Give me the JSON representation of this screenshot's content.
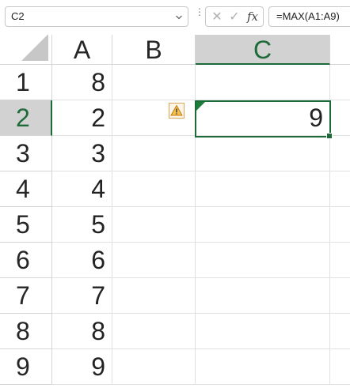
{
  "formula_bar": {
    "name_box": "C2",
    "cancel_icon": "✕",
    "enter_icon": "✓",
    "fx_label": "fx",
    "formula": "=MAX(A1:A9)"
  },
  "columns": [
    "A",
    "B",
    "C"
  ],
  "active_column": "C",
  "rows": [
    "1",
    "2",
    "3",
    "4",
    "5",
    "6",
    "7",
    "8",
    "9"
  ],
  "active_row": "2",
  "cells": {
    "A": [
      "8",
      "2",
      "3",
      "4",
      "5",
      "6",
      "7",
      "8",
      "9"
    ],
    "C2": "9"
  },
  "icons": {
    "select_all": "select-all-triangle",
    "error_warning": "warning-triangle-icon",
    "error_indicator": "green-corner-triangle"
  },
  "colors": {
    "accent": "#1e6b3a",
    "header_active_bg": "#d2d2d2",
    "warning_border": "#d9a55b"
  }
}
